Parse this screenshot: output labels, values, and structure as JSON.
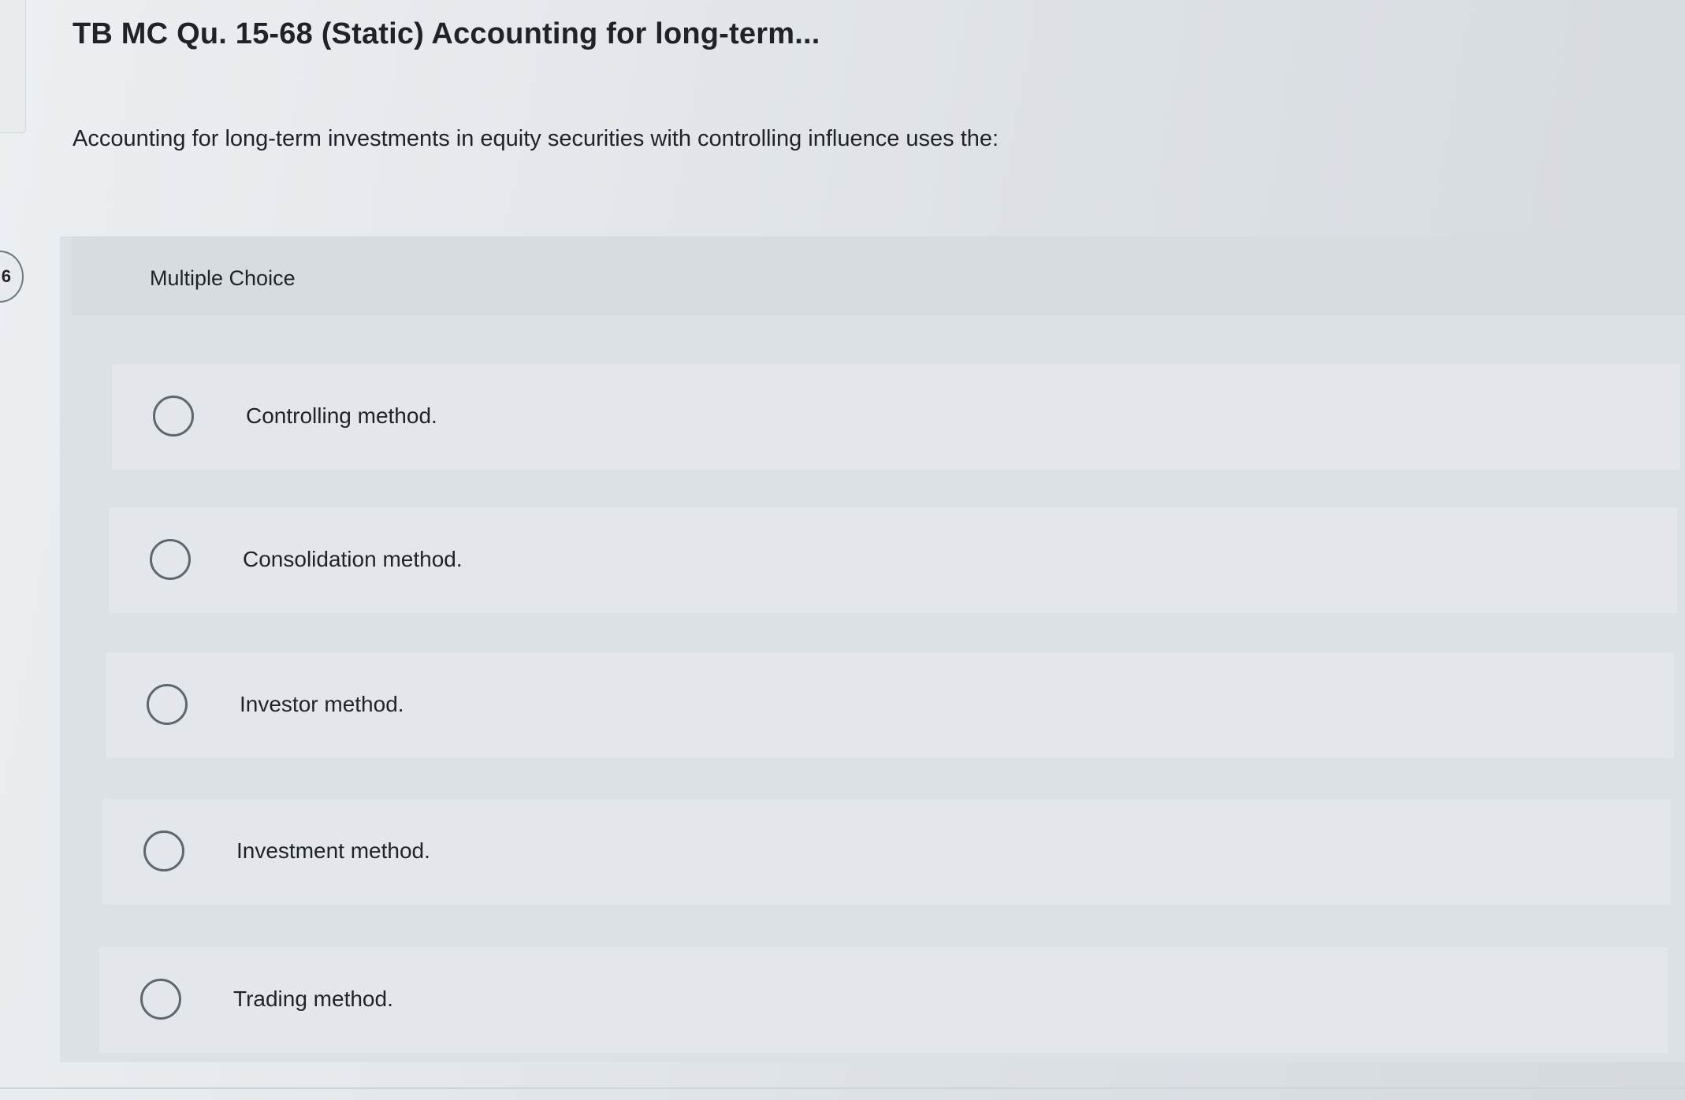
{
  "question": {
    "number_badge": "6",
    "title": "TB MC Qu. 15-68 (Static) Accounting for long-term...",
    "prompt": "Accounting for long-term investments in equity securities with controlling influence uses the:"
  },
  "multiple_choice": {
    "header_label": "Multiple Choice",
    "options": [
      {
        "label": "Controlling method.",
        "selected": false
      },
      {
        "label": "Consolidation method.",
        "selected": false
      },
      {
        "label": "Investor method.",
        "selected": false
      },
      {
        "label": "Investment method.",
        "selected": false
      },
      {
        "label": "Trading method.",
        "selected": false
      }
    ]
  }
}
